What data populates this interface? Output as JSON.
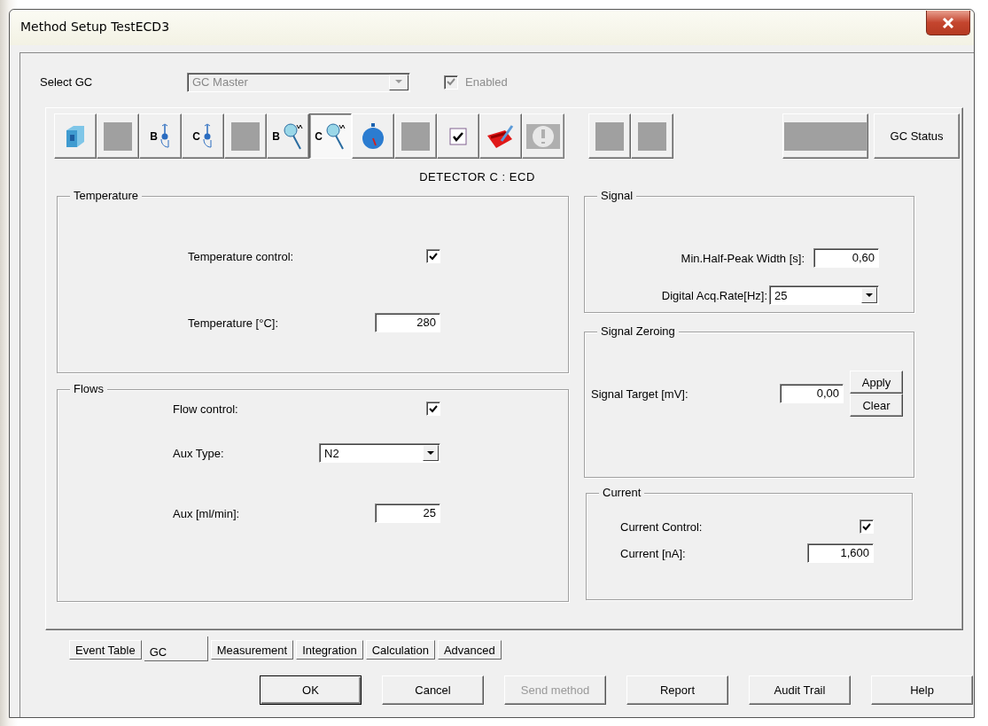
{
  "window": {
    "title": "Method Setup TestECD3"
  },
  "select_gc": {
    "label": "Select GC",
    "value": "GC Master",
    "disabled": true
  },
  "enabled": {
    "label": "Enabled",
    "checked": true,
    "disabled": true
  },
  "toolbar": {
    "groups": [
      [
        {
          "kind": "cube",
          "selected": false,
          "disabled": false
        },
        {
          "kind": "blank",
          "selected": false,
          "disabled": false
        },
        {
          "kind": "valve",
          "label": "B",
          "selected": false,
          "disabled": false
        },
        {
          "kind": "valve",
          "label": "C",
          "selected": false,
          "disabled": false
        },
        {
          "kind": "blank",
          "selected": false,
          "disabled": false
        },
        {
          "kind": "detector",
          "label": "B",
          "selected": false,
          "disabled": false
        },
        {
          "kind": "detector",
          "label": "C",
          "selected": true,
          "disabled": false
        },
        {
          "kind": "timer",
          "selected": false,
          "disabled": false
        },
        {
          "kind": "dot",
          "selected": false,
          "disabled": false
        },
        {
          "kind": "check",
          "selected": false,
          "disabled": false
        },
        {
          "kind": "tool",
          "selected": false,
          "disabled": false
        },
        {
          "kind": "info",
          "selected": false,
          "disabled": true
        }
      ],
      [
        {
          "kind": "blank",
          "selected": false,
          "disabled": false
        },
        {
          "kind": "blank",
          "selected": false,
          "disabled": false
        }
      ],
      [
        {
          "kind": "wide",
          "selected": false,
          "disabled": false
        }
      ]
    ],
    "status_button": "GC Status"
  },
  "detector_title": "DETECTOR C : ECD",
  "temperature": {
    "title": "Temperature",
    "control_label": "Temperature control:",
    "control_checked": true,
    "temp_label": "Temperature [°C]:",
    "temp_value": "280"
  },
  "flows": {
    "title": "Flows",
    "control_label": "Flow control:",
    "control_checked": true,
    "aux_type_label": "Aux Type:",
    "aux_type_value": "N2",
    "aux_label": "Aux [ml/min]:",
    "aux_value": "25"
  },
  "signal": {
    "title": "Signal",
    "width_label": "Min.Half-Peak Width [s]:",
    "width_value": "0,60",
    "rate_label": "Digital Acq.Rate[Hz]:",
    "rate_value": "25"
  },
  "zeroing": {
    "title": "Signal Zeroing",
    "target_label": "Signal Target [mV]:",
    "target_value": "0,00",
    "buttons": [
      "Apply",
      "Clear"
    ]
  },
  "current": {
    "title": "Current",
    "control_label": "Current Control:",
    "control_checked": true,
    "current_label": "Current [nA]:",
    "current_value": "1,600"
  },
  "tabs": [
    {
      "label": "Event Table",
      "selected": false
    },
    {
      "label": "GC",
      "selected": true
    },
    {
      "label": "Measurement",
      "selected": false
    },
    {
      "label": "Integration",
      "selected": false
    },
    {
      "label": "Calculation",
      "selected": false
    },
    {
      "label": "Advanced",
      "selected": false
    }
  ],
  "buttons": [
    {
      "label": "OK",
      "disabled": false,
      "default": true
    },
    {
      "label": "Cancel",
      "disabled": false,
      "default": false
    },
    {
      "label": "Send method",
      "disabled": true,
      "default": false
    },
    {
      "label": "Report",
      "disabled": false,
      "default": false
    },
    {
      "label": "Audit Trail",
      "disabled": false,
      "default": false
    },
    {
      "label": "Help",
      "disabled": false,
      "default": false
    }
  ]
}
